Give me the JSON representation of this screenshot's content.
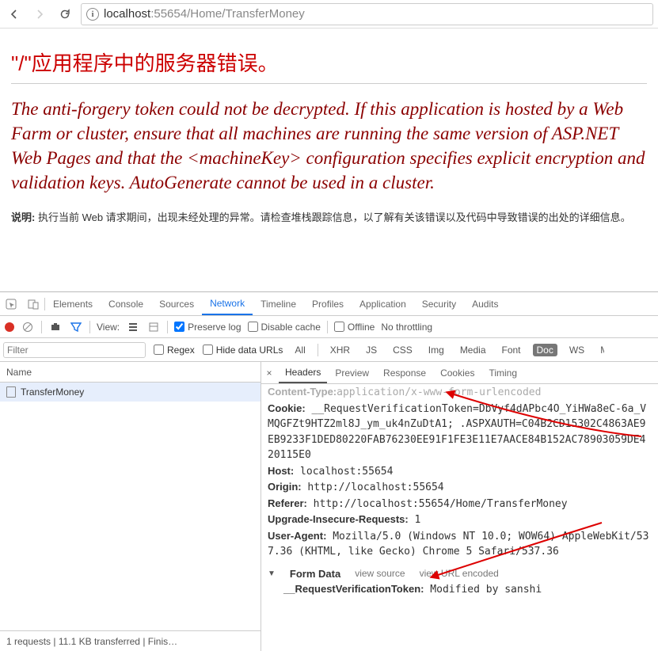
{
  "addressBar": {
    "scheme_host": "localhost",
    "port": ":55654",
    "path": "/Home/TransferMoney"
  },
  "errorPage": {
    "title": "\"/\"应用程序中的服务器错误。",
    "message": "The anti-forgery token could not be decrypted. If this application is hosted by a Web Farm or cluster, ensure that all machines are running the same version of ASP.NET Web Pages and that the <machineKey> configuration specifies explicit encryption and validation keys. AutoGenerate cannot be used in a cluster.",
    "desc_label": "说明:",
    "desc_text": " 执行当前 Web 请求期间，出现未经处理的异常。请检查堆栈跟踪信息，以了解有关该错误以及代码中导致错误的出处的详细信息。"
  },
  "devtools": {
    "tabs": [
      "Elements",
      "Console",
      "Sources",
      "Network",
      "Timeline",
      "Profiles",
      "Application",
      "Security",
      "Audits"
    ],
    "activeTab": "Network",
    "toolbar": {
      "view_label": "View:",
      "preserve": "Preserve log",
      "disable": "Disable cache",
      "offline": "Offline",
      "throttling": "No throttling"
    },
    "filterBar": {
      "placeholder": "Filter",
      "regex": "Regex",
      "hide": "Hide data URLs",
      "types": [
        "All",
        "XHR",
        "JS",
        "CSS",
        "Img",
        "Media",
        "Font",
        "Doc",
        "WS",
        "Manifest"
      ],
      "selected": "Doc"
    },
    "requests": {
      "name_col": "Name",
      "items": [
        "TransferMoney"
      ],
      "footer": "1 requests  |  11.1 KB transferred  |  Finis…"
    },
    "detailTabs": [
      "Headers",
      "Preview",
      "Response",
      "Cookies",
      "Timing"
    ],
    "detailActive": "Headers",
    "headers": {
      "content_type_label": "Content-Type:",
      "content_type_value": "application/x-www-form-urlencoded",
      "cookie_label": "Cookie:",
      "cookie_value": " __RequestVerificationToken=DbVyf4dAPbc4O_YiHWa8eC-6a_VMQGFZt9HTZ2ml8J_ym_uk4nZuDtA1; .ASPXAUTH=C04B2CD15302C4863AE9EB9233F1DED80220FAB76230EE91F1FE3E11E7AACE84B152AC78903059DE420115E0",
      "host_label": "Host:",
      "host_value": " localhost:55654",
      "origin_label": "Origin:",
      "origin_value": " http://localhost:55654",
      "referer_label": "Referer:",
      "referer_value": " http://localhost:55654/Home/TransferMoney",
      "uir_label": "Upgrade-Insecure-Requests:",
      "uir_value": " 1",
      "ua_label": "User-Agent:",
      "ua_value": " Mozilla/5.0 (Windows NT 10.0; WOW64) AppleWebKit/537.36 (KHTML, like Gecko) Chrome 5 Safari/537.36"
    },
    "formData": {
      "section": "Form Data",
      "view_source": "view source",
      "view_url": "view URL encoded",
      "token_label": "__RequestVerificationToken:",
      "token_value": " Modified by sanshi"
    }
  }
}
